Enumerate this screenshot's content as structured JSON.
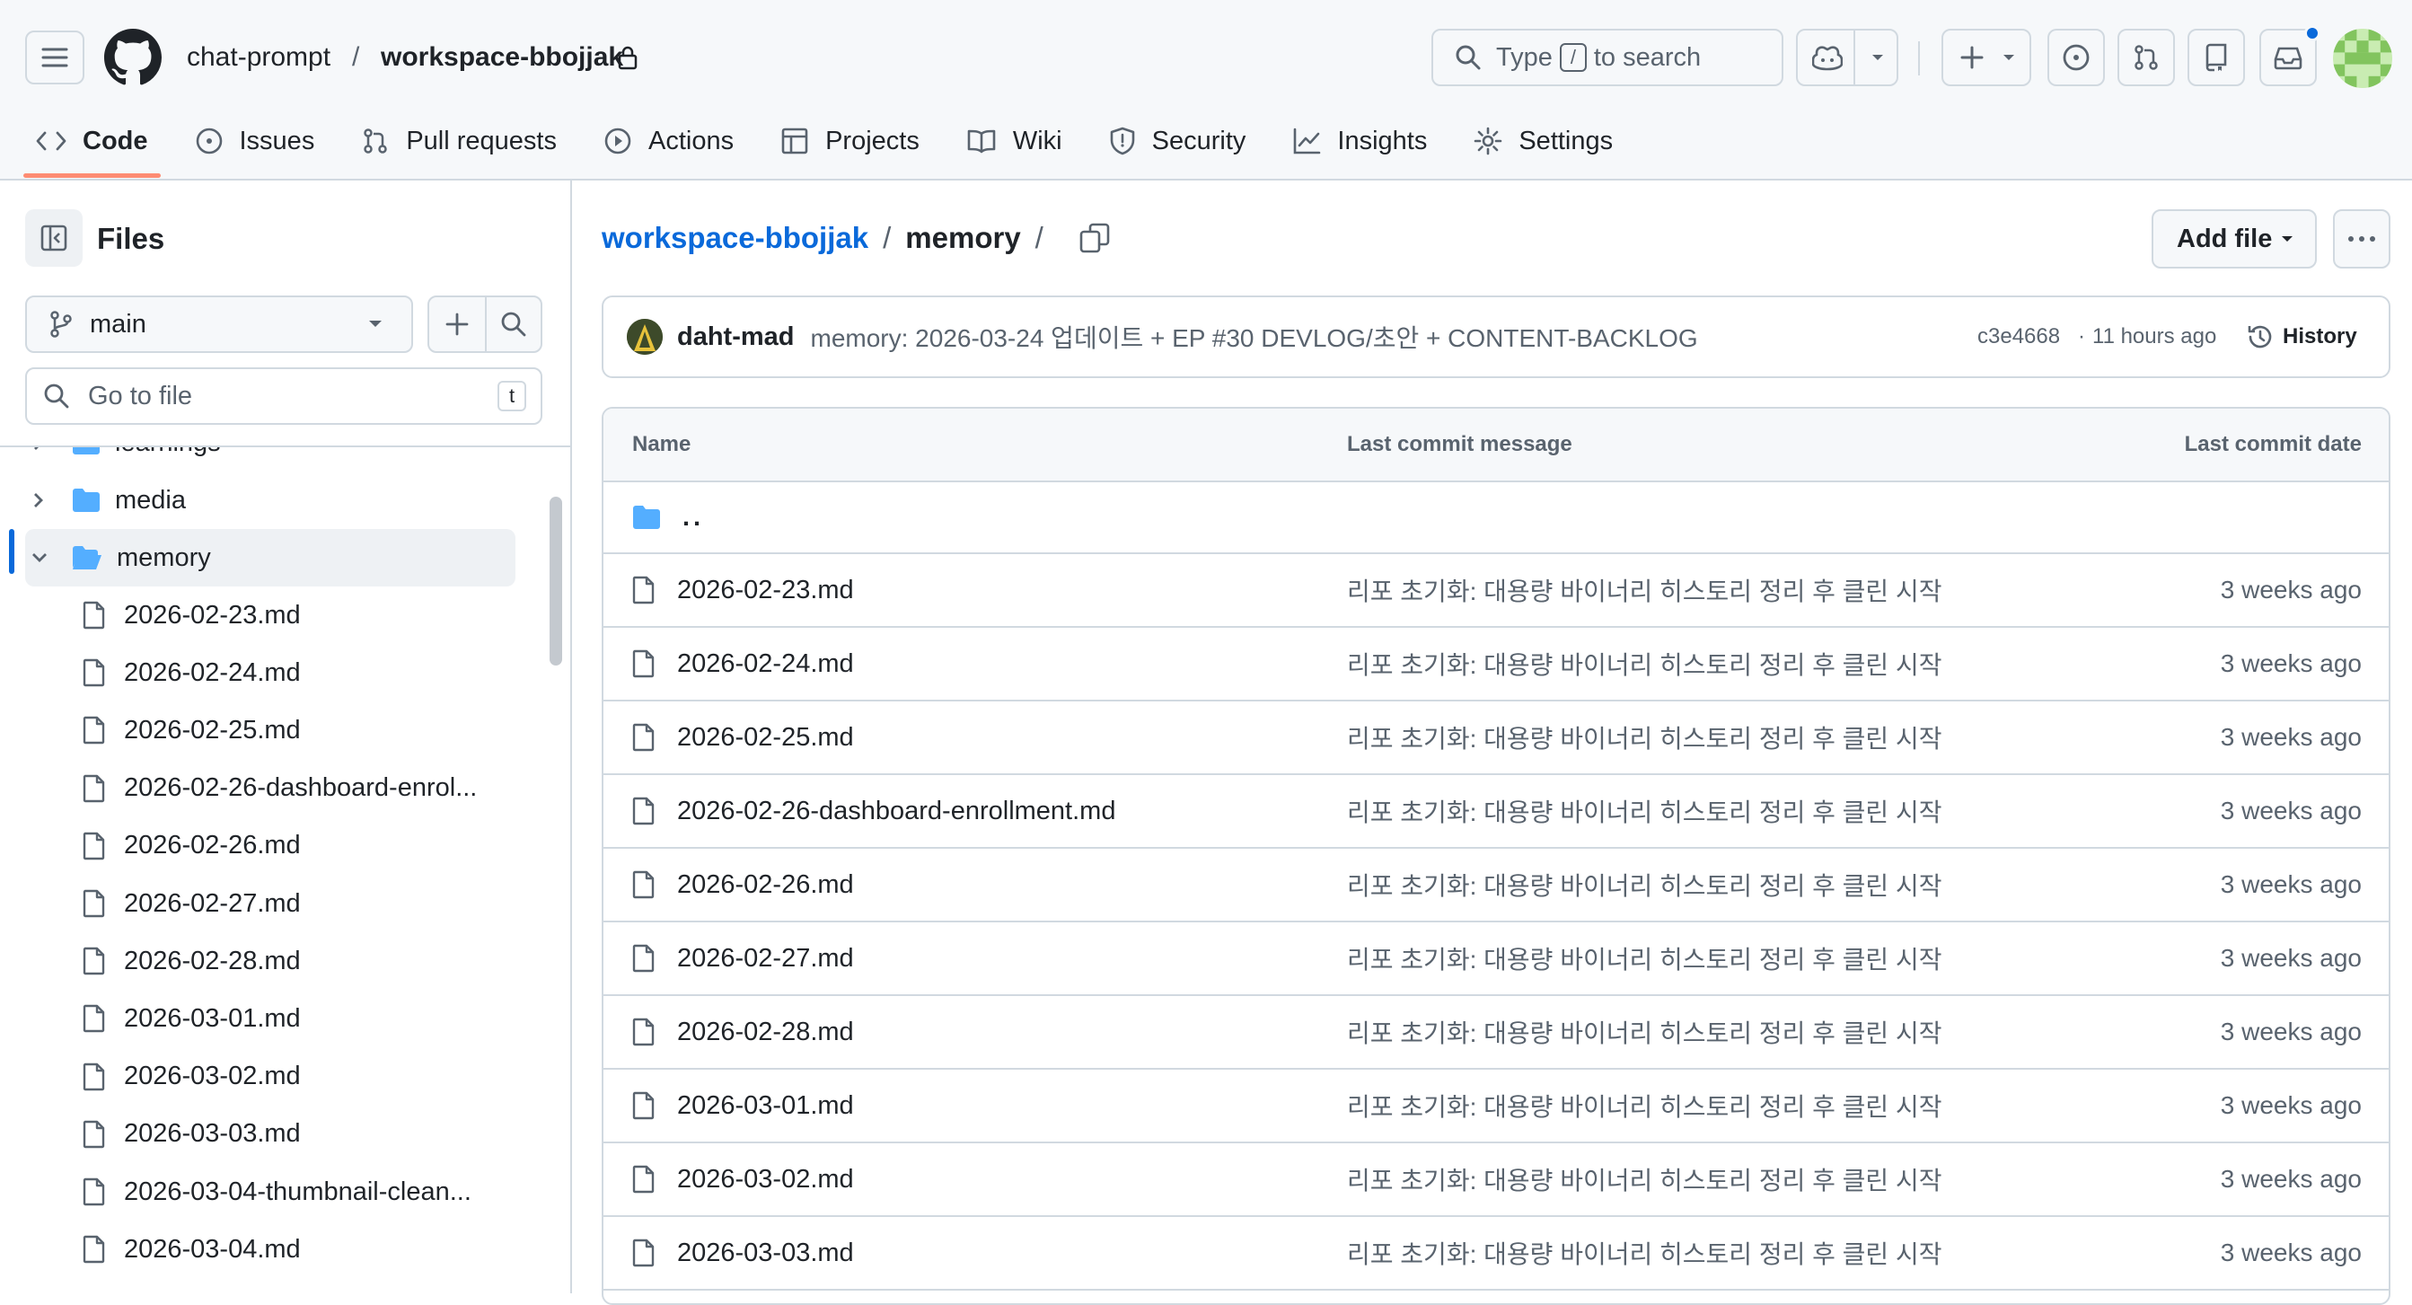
{
  "header": {
    "owner": "chat-prompt",
    "separator": "/",
    "repo": "workspace-bbojjak",
    "search": {
      "prefix": "Type",
      "key": "/",
      "suffix": "to search"
    }
  },
  "tabs": [
    {
      "label": "Code",
      "icon": "code-icon",
      "selected": true
    },
    {
      "label": "Issues",
      "icon": "issue-icon"
    },
    {
      "label": "Pull requests",
      "icon": "pull-request-icon"
    },
    {
      "label": "Actions",
      "icon": "play-icon"
    },
    {
      "label": "Projects",
      "icon": "table-icon"
    },
    {
      "label": "Wiki",
      "icon": "book-icon"
    },
    {
      "label": "Security",
      "icon": "shield-icon"
    },
    {
      "label": "Insights",
      "icon": "graph-icon"
    },
    {
      "label": "Settings",
      "icon": "gear-icon"
    }
  ],
  "sidebar": {
    "title": "Files",
    "branch": "main",
    "goto_placeholder": "Go to file",
    "goto_key": "t",
    "items": [
      {
        "label": "learnings",
        "type": "folder",
        "expanded": false
      },
      {
        "label": "media",
        "type": "folder",
        "expanded": false
      },
      {
        "label": "memory",
        "type": "folder",
        "expanded": true,
        "selected": true
      },
      {
        "label": "2026-02-23.md",
        "type": "file"
      },
      {
        "label": "2026-02-24.md",
        "type": "file"
      },
      {
        "label": "2026-02-25.md",
        "type": "file"
      },
      {
        "label": "2026-02-26-dashboard-enrol...",
        "type": "file"
      },
      {
        "label": "2026-02-26.md",
        "type": "file"
      },
      {
        "label": "2026-02-27.md",
        "type": "file"
      },
      {
        "label": "2026-02-28.md",
        "type": "file"
      },
      {
        "label": "2026-03-01.md",
        "type": "file"
      },
      {
        "label": "2026-03-02.md",
        "type": "file"
      },
      {
        "label": "2026-03-03.md",
        "type": "file"
      },
      {
        "label": "2026-03-04-thumbnail-clean...",
        "type": "file"
      },
      {
        "label": "2026-03-04.md",
        "type": "file"
      }
    ]
  },
  "main": {
    "breadcrumb_repo": "workspace-bbojjak",
    "breadcrumb_sep": "/",
    "breadcrumb_dir": "memory",
    "breadcrumb_trail": "/",
    "add_file_label": "Add file",
    "commit": {
      "author": "daht-mad",
      "message": "memory: 2026-03-24 업데이트 + EP #30 DEVLOG/초안 + CONTENT-BACKLOG",
      "hash": "c3e4668",
      "dot": "·",
      "time": "11 hours ago",
      "history_label": "History"
    },
    "table": {
      "headers": {
        "name": "Name",
        "message": "Last commit message",
        "date": "Last commit date"
      },
      "parent": "..",
      "rows": [
        {
          "name": "2026-02-23.md",
          "message": "리포 초기화: 대용량 바이너리 히스토리 정리 후 클린 시작",
          "date": "3 weeks ago"
        },
        {
          "name": "2026-02-24.md",
          "message": "리포 초기화: 대용량 바이너리 히스토리 정리 후 클린 시작",
          "date": "3 weeks ago"
        },
        {
          "name": "2026-02-25.md",
          "message": "리포 초기화: 대용량 바이너리 히스토리 정리 후 클린 시작",
          "date": "3 weeks ago"
        },
        {
          "name": "2026-02-26-dashboard-enrollment.md",
          "message": "리포 초기화: 대용량 바이너리 히스토리 정리 후 클린 시작",
          "date": "3 weeks ago"
        },
        {
          "name": "2026-02-26.md",
          "message": "리포 초기화: 대용량 바이너리 히스토리 정리 후 클린 시작",
          "date": "3 weeks ago"
        },
        {
          "name": "2026-02-27.md",
          "message": "리포 초기화: 대용량 바이너리 히스토리 정리 후 클린 시작",
          "date": "3 weeks ago"
        },
        {
          "name": "2026-02-28.md",
          "message": "리포 초기화: 대용량 바이너리 히스토리 정리 후 클린 시작",
          "date": "3 weeks ago"
        },
        {
          "name": "2026-03-01.md",
          "message": "리포 초기화: 대용량 바이너리 히스토리 정리 후 클린 시작",
          "date": "3 weeks ago"
        },
        {
          "name": "2026-03-02.md",
          "message": "리포 초기화: 대용량 바이너리 히스토리 정리 후 클린 시작",
          "date": "3 weeks ago"
        },
        {
          "name": "2026-03-03.md",
          "message": "리포 초기화: 대용량 바이너리 히스토리 정리 후 클린 시작",
          "date": "3 weeks ago"
        }
      ]
    }
  },
  "colors": {
    "accent": "#0969da",
    "tab_underline": "#fd8c73",
    "folder": "#54aeff",
    "notification": "#0969da"
  }
}
